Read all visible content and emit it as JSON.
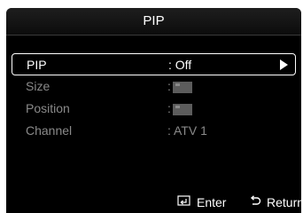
{
  "header": {
    "title": "PIP"
  },
  "menu": {
    "items": [
      {
        "label": "PIP",
        "value": ": Off",
        "selected": true,
        "has_arrow": true
      },
      {
        "label": "Size",
        "value": ":",
        "selected": false,
        "swatch": true
      },
      {
        "label": "Position",
        "value": ":",
        "selected": false,
        "swatch": true
      },
      {
        "label": "Channel",
        "value": ": ATV 1",
        "selected": false
      }
    ]
  },
  "footer": {
    "enter_icon": "enter-icon",
    "enter_label": "Enter",
    "return_icon": "return-icon",
    "return_label": "Return"
  },
  "colors": {
    "panel_bg": "#000000",
    "text_active": "#ffffff",
    "text_inactive": "#8a8a8a"
  }
}
